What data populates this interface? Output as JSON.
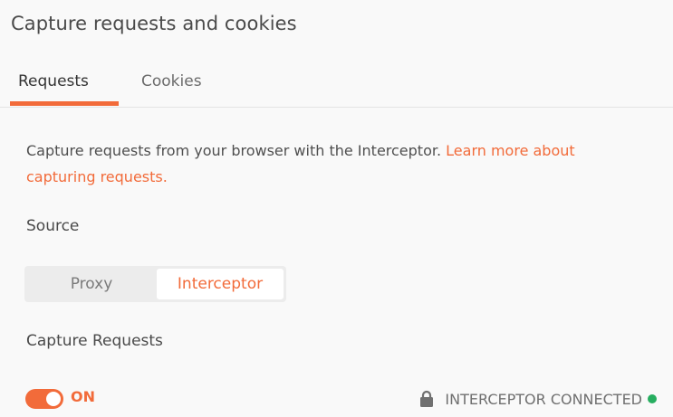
{
  "header": {
    "title": "Capture requests and cookies"
  },
  "tabs": [
    {
      "label": "Requests",
      "active": true
    },
    {
      "label": "Cookies",
      "active": false
    }
  ],
  "description": {
    "text": "Capture requests from your browser with the Interceptor.",
    "link": "Learn more about capturing requests."
  },
  "source": {
    "label": "Source",
    "options": [
      "Proxy",
      "Interceptor"
    ],
    "selected": "Interceptor"
  },
  "capture": {
    "label": "Capture Requests",
    "toggle_state": "ON",
    "status_text": "INTERCEPTOR CONNECTED"
  },
  "colors": {
    "accent": "#f26b3a",
    "connected": "#27ae60"
  },
  "icons": [
    "lock-icon",
    "status-dot-icon"
  ]
}
